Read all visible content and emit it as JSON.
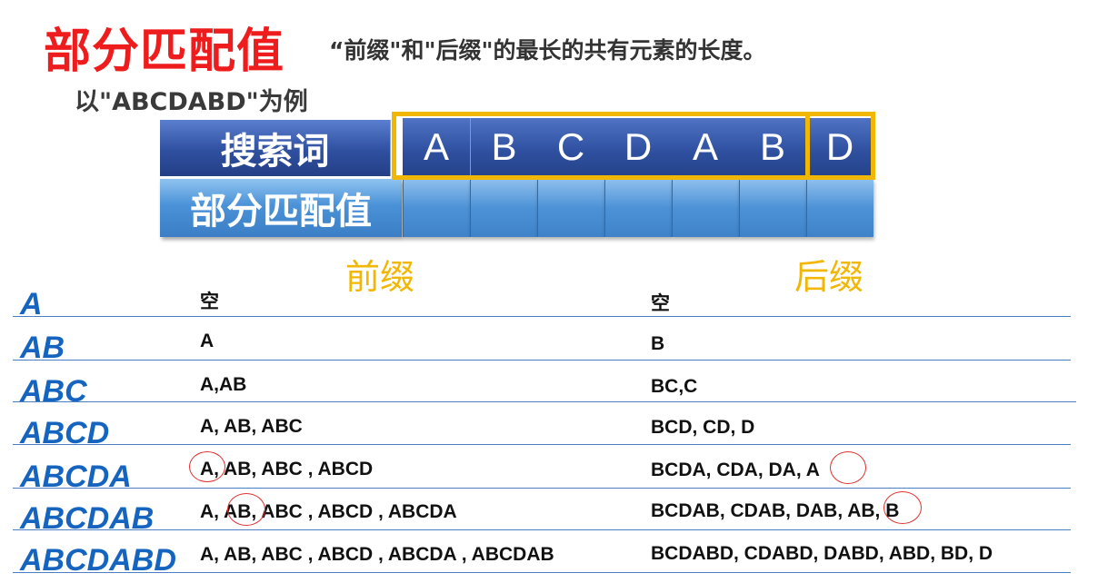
{
  "title": "部分匹配值",
  "subtitle": "“前缀\"和\"后缀\"的最长的共有元素的长度。",
  "example": "以\"ABCDABD\"为例",
  "table": {
    "row1_label": "搜索词",
    "row2_label": "部分匹配值",
    "letters": [
      "A",
      "B",
      "C",
      "D",
      "A",
      "B",
      "D"
    ]
  },
  "prefix_label": "前缀",
  "suffix_label": "后缀",
  "rows": [
    {
      "label": "A",
      "prefixes": "空",
      "suffixes": "空"
    },
    {
      "label": "AB",
      "prefixes": "A",
      "suffixes": "B"
    },
    {
      "label": "ABC",
      "prefixes": "A,AB",
      "suffixes": "BC,C"
    },
    {
      "label": "ABCD",
      "prefixes": "A, AB, ABC",
      "suffixes": "BCD, CD, D"
    },
    {
      "label": "ABCDA",
      "prefixes": "A, AB, ABC , ABCD",
      "suffixes": "BCDA, CDA, DA, A"
    },
    {
      "label": "ABCDAB",
      "prefixes": "A, AB, ABC , ABCD , ABCDA",
      "suffixes": "BCDAB, CDAB, DAB, AB, B"
    },
    {
      "label": "ABCDABD",
      "prefixes": "A, AB, ABC , ABCD , ABCDA , ABCDAB",
      "suffixes": "BCDABD, CDABD, DABD, ABD, BD, D"
    }
  ],
  "colors": {
    "title": "#ee1c1c",
    "highlight_frame": "#f2b705",
    "row_label": "#1565c0",
    "circle": "#e03030"
  }
}
